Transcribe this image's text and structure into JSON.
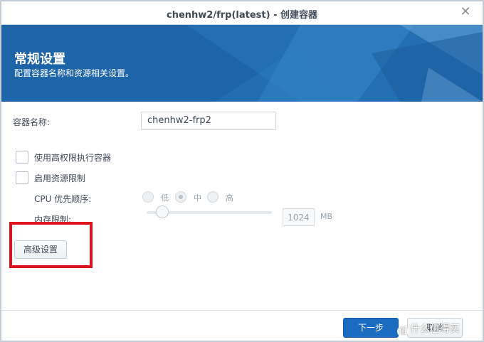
{
  "window": {
    "title": "chenhw2/frp(latest) - 创建容器",
    "close_icon": "close-icon"
  },
  "banner": {
    "title": "常规设置",
    "subtitle": "配置容器名称和资源相关设置。",
    "color": "#1d64a8"
  },
  "form": {
    "container_name_label": "容器名称:",
    "container_name_value": "chenhw2-frp2",
    "privileged_label": "使用高权限执行容器",
    "privileged_checked": false,
    "resource_limit_label": "启用资源限制",
    "resource_limit_checked": false,
    "cpu_label": "CPU 优先顺序:",
    "cpu_options": [
      "低",
      "中",
      "高"
    ],
    "cpu_selected": "中",
    "memory_label": "内存限制:",
    "memory_value": "1024",
    "memory_unit": "MB",
    "memory_slider_level": 0.07,
    "advanced_button": "高级设置"
  },
  "footer": {
    "next_button": "下一步",
    "cancel_button": "取消"
  },
  "watermark": {
    "text": "什么值得买",
    "icon": "值"
  },
  "colors": {
    "accent": "#1b6cc1",
    "highlight": "#e0131c"
  }
}
